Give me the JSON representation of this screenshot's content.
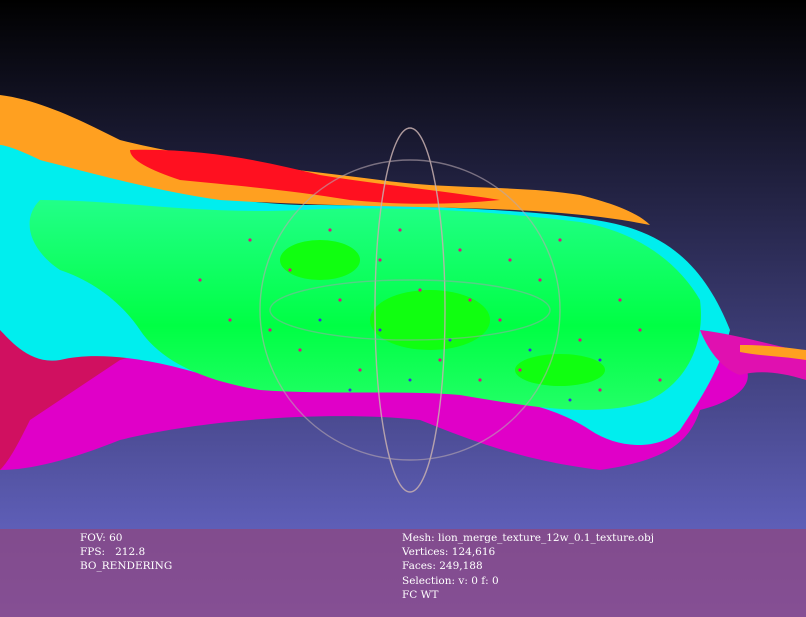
{
  "viewer": {
    "background_top_color": "#000000",
    "background_bottom_color": "#7070d8"
  },
  "info": {
    "fov_label": "FOV:",
    "fov_value": "60",
    "fps_label": "FPS:",
    "fps_value": "212.8",
    "render_mode": "BO_RENDERING",
    "mesh_label": "Mesh:",
    "mesh_name": "lion_merge_texture_12w_0.1_texture.obj",
    "vertices_label": "Vertices:",
    "vertices_value": "124,616",
    "faces_label": "Faces:",
    "faces_value": "249,188",
    "selection_label": "Selection:",
    "selection_value": "v: 0 f: 0",
    "flags": "FC WT"
  },
  "colors": {
    "panel": "#8c4682",
    "mesh_green": "#00ff66",
    "mesh_cyan": "#00f0f0",
    "mesh_magenta": "#e000c8",
    "mesh_red": "#ff1020",
    "mesh_orange": "#ffa020",
    "trackball": "#c8b0b0"
  },
  "icons": {
    "trackball": "trackball-gizmo-icon"
  }
}
